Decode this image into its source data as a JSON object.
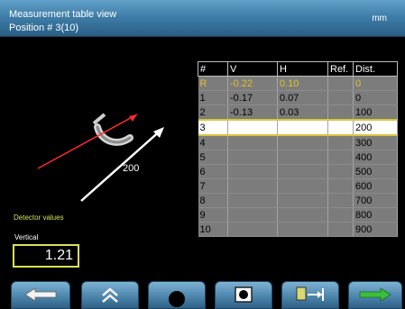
{
  "header": {
    "title": "Measurement table view",
    "subtitle": "Position # 3(10)",
    "unit": "mm"
  },
  "schematic": {
    "distance_label": "200"
  },
  "detector": {
    "section_label": "Detector values",
    "vertical_label": "Vertical",
    "vertical_value": "1.21"
  },
  "table": {
    "columns": [
      "#",
      "V",
      "H",
      "Ref.",
      "Dist."
    ],
    "rows": [
      {
        "num": "R",
        "v": "-0.22",
        "h": "0.10",
        "ref": "",
        "dist": "0"
      },
      {
        "num": "1",
        "v": "-0.17",
        "h": "0.07",
        "ref": "",
        "dist": "0"
      },
      {
        "num": "2",
        "v": "-0.13",
        "h": "0.03",
        "ref": "",
        "dist": "100"
      },
      {
        "num": "3",
        "v": "",
        "h": "",
        "ref": "",
        "dist": "200"
      },
      {
        "num": "4",
        "v": "",
        "h": "",
        "ref": "",
        "dist": "300"
      },
      {
        "num": "5",
        "v": "",
        "h": "",
        "ref": "",
        "dist": "400"
      },
      {
        "num": "6",
        "v": "",
        "h": "",
        "ref": "",
        "dist": "500"
      },
      {
        "num": "7",
        "v": "",
        "h": "",
        "ref": "",
        "dist": "600"
      },
      {
        "num": "8",
        "v": "",
        "h": "",
        "ref": "",
        "dist": "700"
      },
      {
        "num": "9",
        "v": "",
        "h": "",
        "ref": "",
        "dist": "800"
      },
      {
        "num": "10",
        "v": "",
        "h": "",
        "ref": "",
        "dist": "900"
      }
    ],
    "selected_row": "3"
  },
  "toolbar": {
    "buttons": [
      {
        "icon": "arrow-left-icon"
      },
      {
        "icon": "double-chevron-up-icon"
      },
      {
        "icon": "measure-point-icon"
      },
      {
        "icon": "record-icon"
      },
      {
        "icon": "distance-icon"
      },
      {
        "icon": "arrow-right-icon"
      }
    ]
  },
  "colors": {
    "accent_yellow": "#d7e05a",
    "header_blue": "#3f7ea9",
    "next_green": "#3bbf3b",
    "ref_row_text": "#e0c12a"
  }
}
